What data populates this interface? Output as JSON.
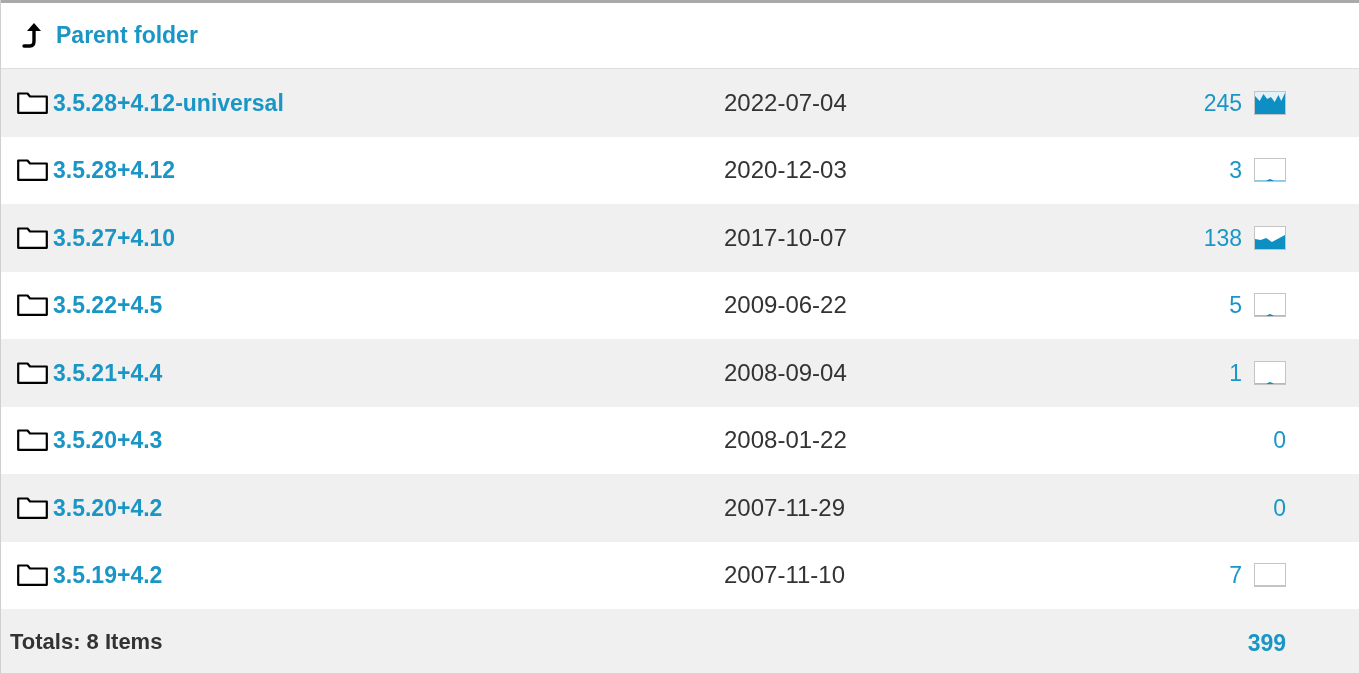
{
  "parent_link": {
    "label": "Parent folder"
  },
  "rows": [
    {
      "name": "3.5.28+4.12-universal",
      "date": "2022-07-04",
      "downloads": "245",
      "kind": "high"
    },
    {
      "name": "3.5.28+4.12",
      "date": "2020-12-03",
      "downloads": "3",
      "kind": "low"
    },
    {
      "name": "3.5.27+4.10",
      "date": "2017-10-07",
      "downloads": "138",
      "kind": "medium"
    },
    {
      "name": "3.5.22+4.5",
      "date": "2009-06-22",
      "downloads": "5",
      "kind": "low"
    },
    {
      "name": "3.5.21+4.4",
      "date": "2008-09-04",
      "downloads": "1",
      "kind": "low"
    },
    {
      "name": "3.5.20+4.3",
      "date": "2008-01-22",
      "downloads": "0",
      "kind": "none"
    },
    {
      "name": "3.5.20+4.2",
      "date": "2007-11-29",
      "downloads": "0",
      "kind": "none"
    },
    {
      "name": "3.5.19+4.2",
      "date": "2007-11-10",
      "downloads": "7",
      "kind": "flat"
    }
  ],
  "totals": {
    "label": "Totals: 8 Items",
    "downloads": "399"
  }
}
